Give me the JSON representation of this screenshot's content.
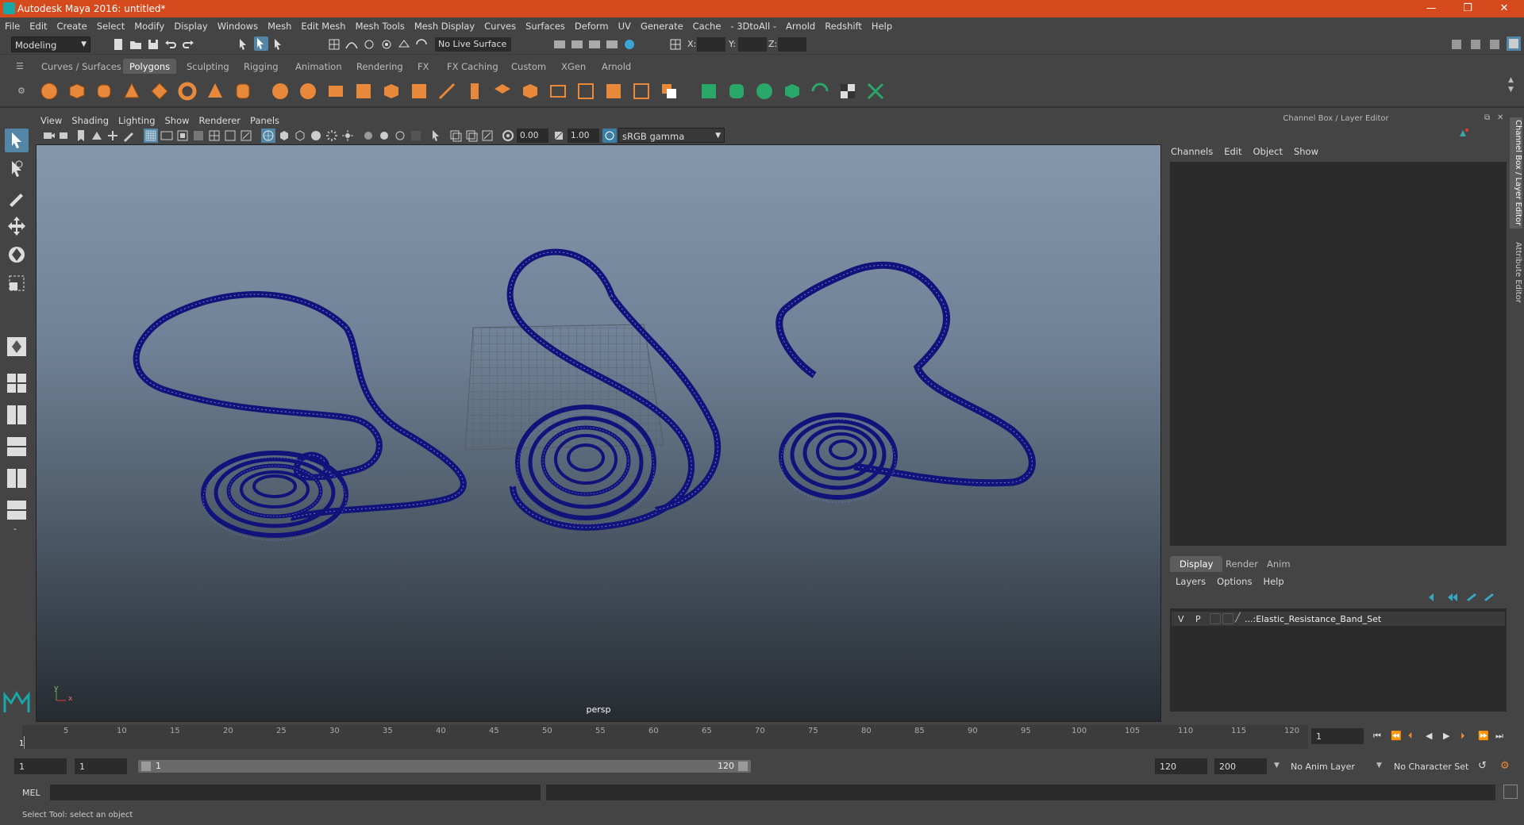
{
  "window": {
    "title": "Autodesk Maya 2016: untitled*",
    "controls": {
      "minimize": "—",
      "restore": "❐",
      "close": "✕"
    }
  },
  "menubar": [
    "File",
    "Edit",
    "Create",
    "Select",
    "Modify",
    "Display",
    "Windows",
    "Mesh",
    "Edit Mesh",
    "Mesh Tools",
    "Mesh Display",
    "Curves",
    "Surfaces",
    "Deform",
    "UV",
    "Generate",
    "Cache",
    "- 3DtoAll -",
    "Arnold",
    "Redshift",
    "Help"
  ],
  "statusline": {
    "mode": "Modeling",
    "live_surface": "No Live Surface",
    "x_label": "X:",
    "y_label": "Y:",
    "z_label": "Z:"
  },
  "shelf": {
    "tabs": [
      "Curves / Surfaces",
      "Polygons",
      "Sculpting",
      "Rigging",
      "Animation",
      "Rendering",
      "FX",
      "FX Caching",
      "Custom",
      "XGen",
      "Arnold"
    ],
    "active_tab": "Polygons"
  },
  "viewport": {
    "menu": [
      "View",
      "Shading",
      "Lighting",
      "Show",
      "Renderer",
      "Panels"
    ],
    "exposure": "0.00",
    "gamma": "1.00",
    "color_space": "sRGB gamma",
    "camera_label": "persp",
    "axis_x": "x",
    "axis_y": "y"
  },
  "right_panel": {
    "title": "Channel Box / Layer Editor",
    "channel_menu": [
      "Channels",
      "Edit",
      "Object",
      "Show"
    ],
    "layer_tabs": [
      "Display",
      "Render",
      "Anim"
    ],
    "active_layer_tab": "Display",
    "layer_menu": [
      "Layers",
      "Options",
      "Help"
    ],
    "layer": {
      "v": "V",
      "p": "P",
      "name": "...:Elastic_Resistance_Band_Set"
    },
    "side_tabs": [
      "Channel Box / Layer Editor",
      "Attribute Editor"
    ]
  },
  "timeline": {
    "start_marker": "1",
    "ticks": [
      "5",
      "10",
      "15",
      "20",
      "25",
      "30",
      "35",
      "40",
      "45",
      "50",
      "55",
      "60",
      "65",
      "70",
      "75",
      "80",
      "85",
      "90",
      "95",
      "100",
      "105",
      "110",
      "115",
      "120"
    ],
    "current_frame": "1"
  },
  "range": {
    "start": "1",
    "anim_start": "1",
    "slider_start": "1",
    "slider_end": "120",
    "anim_end": "120",
    "end": "200",
    "anim_layer": "No Anim Layer",
    "character_set": "No Character Set"
  },
  "command": {
    "label": "MEL"
  },
  "help_line": "Select Tool: select an object",
  "colors": {
    "titlebar": "#d54a1c",
    "wireframe": "#11127a",
    "accent": "#5d5d5d"
  }
}
